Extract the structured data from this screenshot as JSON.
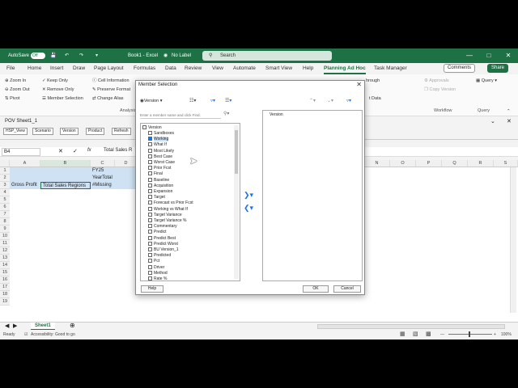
{
  "titlebar": {
    "autosave_label": "AutoSave",
    "autosave_state": "Off",
    "doc_title": "Book1 - Excel",
    "label_status": "No Label",
    "search_placeholder": "Search",
    "accent": "#1e7145"
  },
  "tabs": [
    "File",
    "Home",
    "Insert",
    "Draw",
    "Page Layout",
    "Formulas",
    "Data",
    "Review",
    "View",
    "Automate",
    "Smart View",
    "Help",
    "Planning Ad Hoc",
    "Task Manager"
  ],
  "active_tab": "Planning Ad Hoc",
  "comments_label": "Comments",
  "share_label": "Share",
  "ribbon": {
    "zoom_in": "Zoom In",
    "zoom_out": "Zoom Out",
    "pivot": "Pivot",
    "keep_only": "Keep Only",
    "remove_only": "Remove Only",
    "member_selection": "Member Selection",
    "cell_information": "Cell Information",
    "preserve_format": "Preserve Format",
    "change_alias": "Change Alias",
    "analysis_group": "Analysis",
    "through": "hrough",
    "data": "t Data",
    "approvals": "Approvals",
    "copy_version": "Copy Version",
    "workflow_group": "Workflow",
    "query": "Query",
    "query_group": "Query"
  },
  "pov": {
    "title": "POV Sheet1_1",
    "items": [
      "HSP_View",
      "Scenario",
      "Version",
      "Product",
      "Refresh"
    ]
  },
  "formula_bar": {
    "name_box": "B4",
    "fx": "fx",
    "content": "Total Sales R"
  },
  "grid": {
    "columns": [
      "A",
      "B",
      "C",
      "D",
      "R",
      "S",
      "T"
    ],
    "right_columns": [
      "N",
      "O",
      "P",
      "Q",
      "R",
      "S",
      "T"
    ],
    "rows": [
      "1",
      "2",
      "3",
      "4",
      "5",
      "6",
      "7",
      "8",
      "9",
      "10",
      "11",
      "12",
      "13",
      "14",
      "15",
      "16",
      "17",
      "18",
      "19"
    ],
    "c2": "FY25",
    "c3": "YearTotal",
    "a4": "Gross Profit",
    "b4": "Total Sales Regions",
    "c4": "#Missing"
  },
  "sheet_tab": "Sheet1",
  "status": {
    "ready": "Ready",
    "accessibility": "Accessibility: Good to go",
    "zoom": "100%"
  },
  "dialog": {
    "title": "Member Selection",
    "dimension": "Version",
    "search_placeholder": "Enter a member name and click Find.",
    "root": "Version",
    "members": [
      "Sandboxes",
      "Working",
      "What If",
      "Most Likely",
      "Best Case",
      "Worst Case",
      "Prior Fcst",
      "Final",
      "Baseline",
      "Acquisition",
      "Expansion",
      "Target",
      "Forecast vs Prior Fcst",
      "Working vs What If",
      "Target Variance",
      "Target Variance %",
      "Commentary",
      "Predict",
      "Predict Best",
      "Predict Worst",
      "BU Version_1",
      "Predicted",
      "Pct",
      "Driver",
      "Method",
      "Rate %"
    ],
    "checked": "Working",
    "selected_item": "Version",
    "help": "Help",
    "ok": "OK",
    "cancel": "Cancel"
  }
}
